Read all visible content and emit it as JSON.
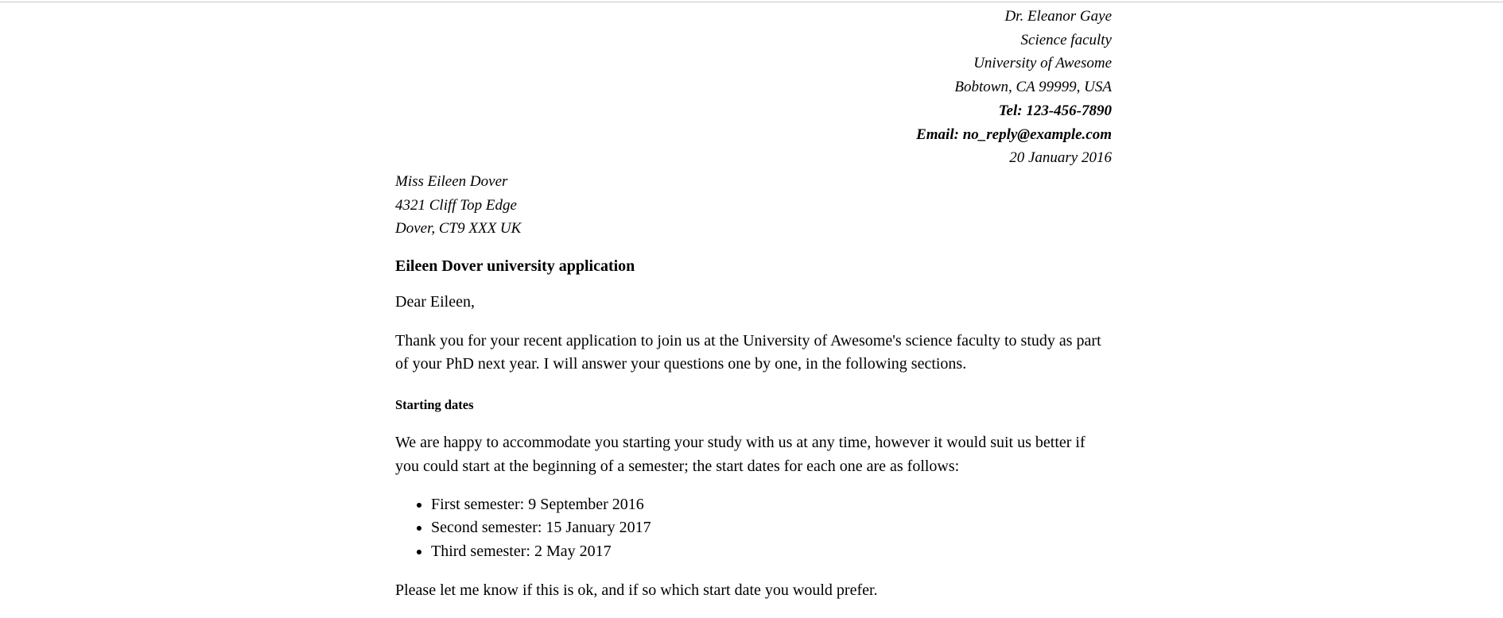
{
  "sender": {
    "name": "Dr. Eleanor Gaye",
    "department": "Science faculty",
    "institution": "University of Awesome",
    "location": "Bobtown, CA 99999, USA",
    "tel": "Tel: 123-456-7890",
    "email": "Email: no_reply@example.com",
    "date": "20 January 2016"
  },
  "recipient": {
    "name": "Miss Eileen Dover",
    "street": "4321 Cliff Top Edge",
    "city": "Dover, CT9 XXX UK"
  },
  "subject": "Eileen Dover university application",
  "salutation": "Dear Eileen,",
  "paragraph1": "Thank you for your recent application to join us at the University of Awesome's science faculty to study as part of your PhD next year. I will answer your questions one by one, in the following sections.",
  "section": {
    "heading": "Starting dates",
    "intro": "We are happy to accommodate you starting your study with us at any time, however it would suit us better if you could start at the beginning of a semester; the start dates for each one are as follows:",
    "dates": [
      "First semester: 9 September 2016",
      "Second semester: 15 January 2017",
      "Third semester: 2 May 2017"
    ],
    "closing": "Please let me know if this is ok, and if so which start date you would prefer."
  }
}
